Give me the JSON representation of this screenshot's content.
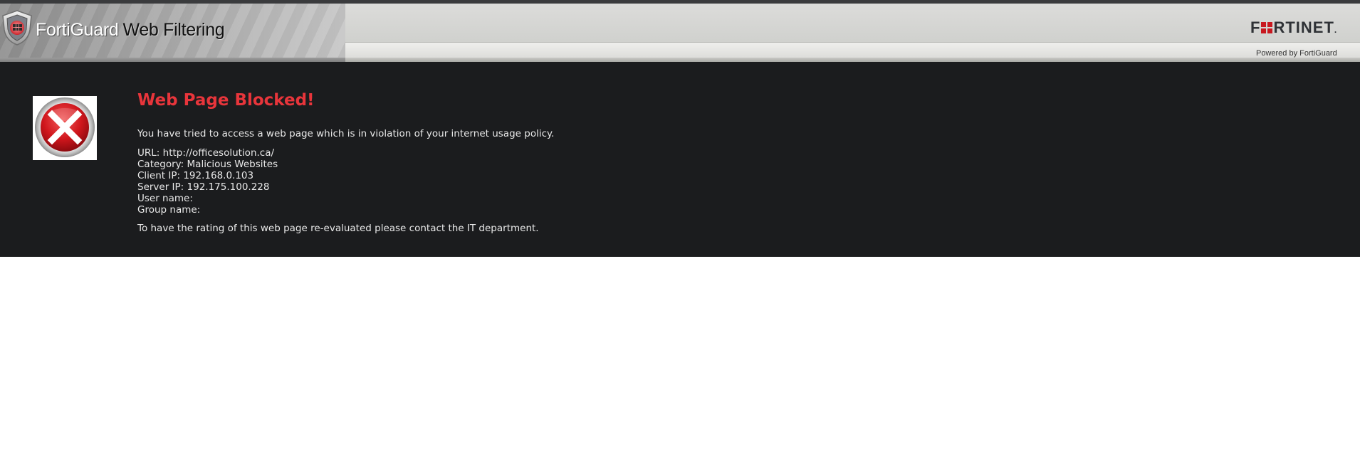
{
  "header": {
    "brand": "FortiGuard",
    "product": "Web Filtering",
    "logo": {
      "prefix": "F",
      "suffix": "RTINET",
      "trademark": "."
    },
    "powered_by": "Powered by FortiGuard"
  },
  "block": {
    "icon": "error-x-icon",
    "title": "Web Page Blocked!",
    "intro": "You have tried to access a web page which is in violation of your internet usage policy.",
    "details": [
      {
        "label": "URL:",
        "value": "http://officesolution.ca/"
      },
      {
        "label": "Category:",
        "value": "Malicious Websites"
      },
      {
        "label": "Client IP:",
        "value": "192.168.0.103"
      },
      {
        "label": "Server IP:",
        "value": "192.175.100.228"
      },
      {
        "label": "User name:",
        "value": ""
      },
      {
        "label": "Group name:",
        "value": ""
      }
    ],
    "footer": "To have the rating of this web page re-evaluated please contact the IT department."
  },
  "colors": {
    "title_red": "#e8353b",
    "panel_bg": "#1b1c1e",
    "text": "#e8e8e8",
    "fortinet_red": "#c8181f"
  }
}
